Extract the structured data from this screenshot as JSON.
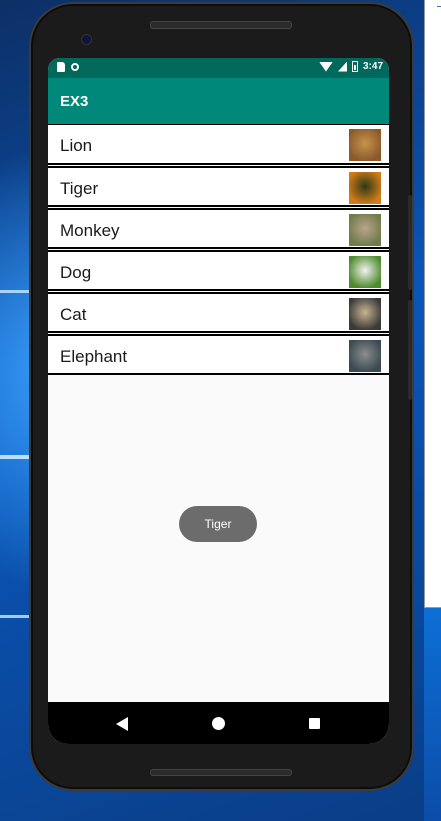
{
  "app": {
    "title": "EX3"
  },
  "status_bar": {
    "time": "3:47",
    "icons": [
      "sd-card-icon",
      "circle-icon",
      "wifi-icon",
      "signal-icon",
      "battery-icon"
    ]
  },
  "list": {
    "items": [
      {
        "label": "Lion",
        "icon": "lion-thumbnail",
        "colors": [
          "#8a5a2b",
          "#c7934a"
        ]
      },
      {
        "label": "Tiger",
        "icon": "tiger-thumbnail",
        "colors": [
          "#d27b1a",
          "#2b3a16"
        ]
      },
      {
        "label": "Monkey",
        "icon": "monkey-thumbnail",
        "colors": [
          "#6f7b4a",
          "#b9a48e"
        ]
      },
      {
        "label": "Dog",
        "icon": "dog-thumbnail",
        "colors": [
          "#4e8a2d",
          "#f2f2f2"
        ]
      },
      {
        "label": "Cat",
        "icon": "cat-thumbnail",
        "colors": [
          "#3a3a3a",
          "#c9b391"
        ]
      },
      {
        "label": "Elephant",
        "icon": "elephant-thumbnail",
        "colors": [
          "#3a4a52",
          "#8c8c8c"
        ]
      }
    ]
  },
  "toast": {
    "text": "Tiger"
  },
  "nav_bar": {
    "buttons": [
      "back-icon",
      "home-icon",
      "recents-icon"
    ]
  },
  "colors": {
    "status_bar": "#00695c",
    "app_bar": "#00897b",
    "toast": "#6c6c6c"
  }
}
